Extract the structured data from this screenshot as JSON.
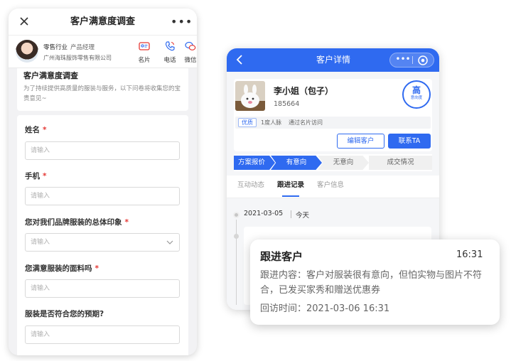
{
  "left_phone": {
    "title": "客户满意度调查",
    "more": "•••",
    "profile": {
      "industry": "零售行业",
      "role": "产品经理",
      "company": "广州海珠服饰零售有限公司",
      "actions": [
        "名片",
        "电话",
        "微信"
      ]
    },
    "intro": {
      "title": "客户满意度调查",
      "description": "为了持续提供高质量的服装与服务，以下问卷将收集您的宝贵意见~"
    },
    "fields": [
      {
        "label": "姓名",
        "required": "*",
        "placeholder": "请输入"
      },
      {
        "label": "手机",
        "required": "*",
        "placeholder": "请输入"
      },
      {
        "label": "您对我们品牌服装的总体印象",
        "required": "*",
        "placeholder": "请输入"
      },
      {
        "label": "您满意服装的面料吗",
        "required": "*",
        "placeholder": "请输入"
      },
      {
        "label": "服装是否符合您的预期?",
        "required": "",
        "placeholder": "请输入"
      }
    ]
  },
  "right_phone": {
    "title": "客户详情",
    "capsule_dots": "•••",
    "customer": {
      "name": "李小姐（包子）",
      "phone": "185664",
      "intent_level": "高",
      "intent_sub": "意向度",
      "tag_quality": "优质",
      "tag_degree": "1度人脉",
      "tag_via": "通过名片访问"
    },
    "buttons": {
      "edit": "编辑客户",
      "contact": "联系TA"
    },
    "stages": [
      "方案报价",
      "有意向",
      "无意向",
      "成交情况"
    ],
    "tabs": [
      "互动动态",
      "跟进记录",
      "客户信息"
    ],
    "timeline": {
      "date": "2021-03-05",
      "day": "今天"
    }
  },
  "followup": {
    "title": "跟进客户",
    "time": "16:31",
    "content": "跟进内容：客户对服装很有意向，但怕实物与图片不符合，已发买家秀和赠送优惠券",
    "revisit": "回访时间：2021-03-06 16:31"
  },
  "colors": {
    "primary": "#2f6af0",
    "required": "#e53935"
  }
}
